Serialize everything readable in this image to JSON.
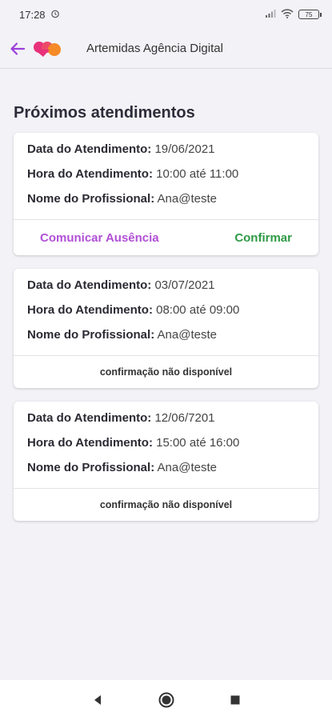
{
  "status_bar": {
    "time": "17:28",
    "battery": "75",
    "icons": [
      "alarm-icon",
      "signal-icon",
      "wifi-icon",
      "battery-icon"
    ]
  },
  "app_bar": {
    "title": "Artemidas Agência Digital",
    "back_icon": "arrow-left-icon",
    "logo": "heart-logo"
  },
  "colors": {
    "accent": "#9b3fdc",
    "absence": "#b150d6",
    "confirm": "#2e9a45",
    "logo_pink": "#e8317a",
    "logo_orange": "#f58a26"
  },
  "section_title": "Próximos atendimentos",
  "labels": {
    "date": "Data do Atendimento:",
    "time": "Hora do Atendimento:",
    "professional": "Nome do Profissional:"
  },
  "appointments": [
    {
      "date": "19/06/2021",
      "time": "10:00 até 11:00",
      "professional": "Ana@teste",
      "absence_label": "Comunicar Ausência",
      "confirm_label": "Confirmar"
    },
    {
      "date": "03/07/2021",
      "time": "08:00 até 09:00",
      "professional": "Ana@teste",
      "unavailable_label": "confirmação não disponível"
    },
    {
      "date": "12/06/7201",
      "time": "15:00 até 16:00",
      "professional": "Ana@teste",
      "unavailable_label": "confirmação não disponível"
    }
  ],
  "nav_bar": {
    "buttons": [
      "back-triangle-icon",
      "home-circle-icon",
      "recents-square-icon"
    ]
  }
}
